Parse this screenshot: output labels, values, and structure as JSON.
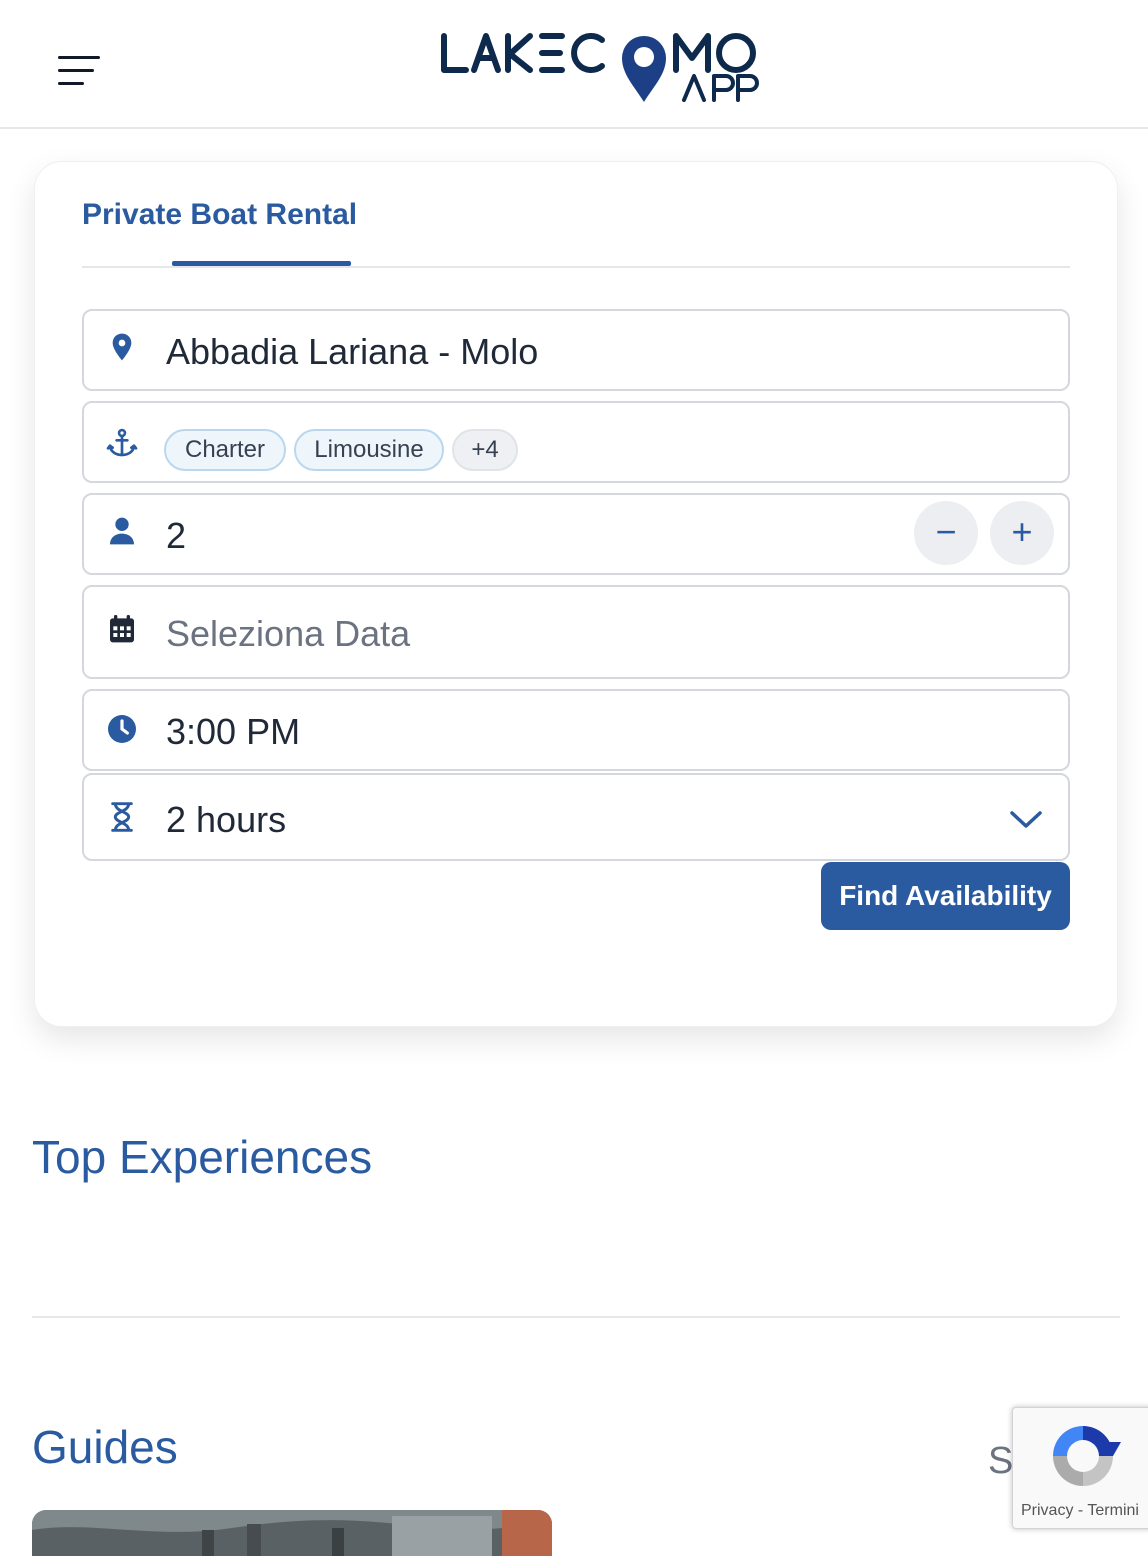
{
  "header": {
    "logo_text": "LAKECOMO APP",
    "menu_icon": "hamburger-menu-icon"
  },
  "booking": {
    "tab_label": "Private Boat Rental",
    "location": {
      "icon": "map-pin-icon",
      "value": "Abbadia Lariana - Molo"
    },
    "boat_types": {
      "icon": "anchor-icon",
      "chips": [
        "Charter",
        "Limousine",
        "+4"
      ]
    },
    "guests": {
      "icon": "user-icon",
      "value": "2",
      "decrement_label": "−",
      "increment_label": "+"
    },
    "date": {
      "icon": "calendar-icon",
      "placeholder": "Seleziona Data"
    },
    "time": {
      "icon": "clock-icon",
      "value": "3:00 PM"
    },
    "duration": {
      "icon": "hourglass-icon",
      "value": "2 hours",
      "dropdown_icon": "chevron-down-icon"
    },
    "find_button_label": "Find Availability"
  },
  "sections": {
    "top_experiences_title": "Top Experiences",
    "guides_title": "Guides",
    "guides_see_all_partial": "S"
  },
  "recaptcha": {
    "links": "Privacy - Termini"
  },
  "colors": {
    "accent": "#2a5ba0",
    "logo_navy": "#0d2a4d",
    "field_border": "#d4d7dc",
    "chip_bg": "#eef5fb"
  }
}
